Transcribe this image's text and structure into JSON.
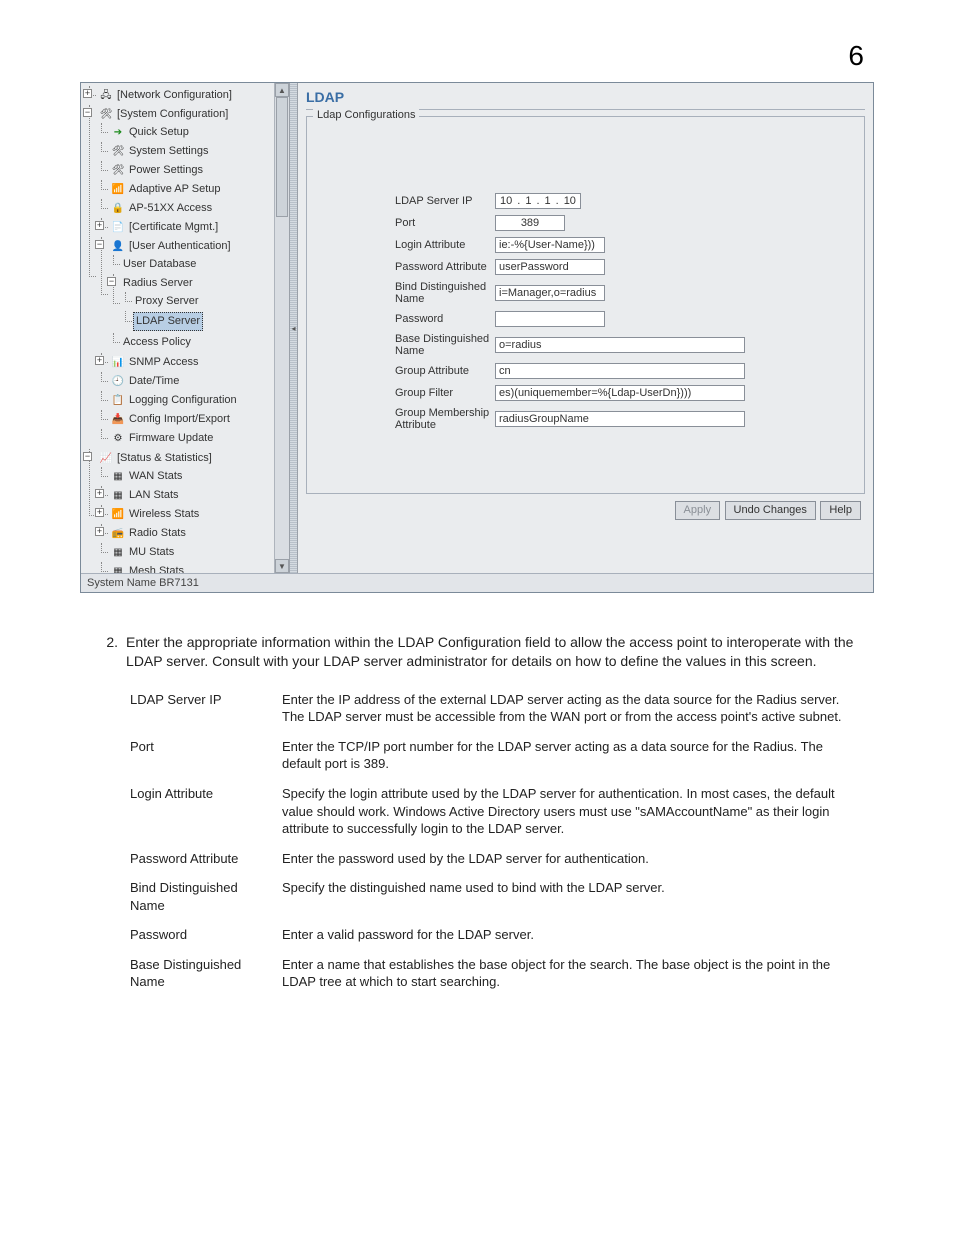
{
  "page_number": "6",
  "tree": {
    "network_configuration": "[Network Configuration]",
    "system_configuration": "[System Configuration]",
    "quick_setup": "Quick Setup",
    "system_settings": "System Settings",
    "power_settings": "Power Settings",
    "adaptive_ap_setup": "Adaptive AP Setup",
    "ap51xx_access": "AP-51XX Access",
    "certificate_mgmt": "[Certificate Mgmt.]",
    "user_authentication": "[User Authentication]",
    "user_database": "User Database",
    "radius_server": "Radius Server",
    "proxy_server": "Proxy Server",
    "ldap_server": "LDAP Server",
    "access_policy": "Access Policy",
    "snmp_access": "SNMP Access",
    "date_time": "Date/Time",
    "logging_configuration": "Logging Configuration",
    "config_import_export": "Config Import/Export",
    "firmware_update": "Firmware Update",
    "status_statistics": "[Status & Statistics]",
    "wan_stats": "WAN Stats",
    "lan_stats": "LAN Stats",
    "wireless_stats": "Wireless Stats",
    "radio_stats": "Radio Stats",
    "mu_stats": "MU Stats",
    "mesh_stats": "Mesh Stats"
  },
  "main": {
    "title": "LDAP",
    "legend": "Ldap Configurations",
    "labels": {
      "ldap_server_ip": "LDAP Server IP",
      "port": "Port",
      "login_attribute": "Login Attribute",
      "password_attribute": "Password Attribute",
      "bind_dn": "Bind Distinguished Name",
      "password": "Password",
      "base_dn": "Base Distinguished Name",
      "group_attribute": "Group Attribute",
      "group_filter": "Group Filter",
      "group_membership_attribute": "Group Membership Attribute"
    },
    "values": {
      "ip_o1": "10",
      "ip_o2": "1",
      "ip_o3": "1",
      "ip_o4": "10",
      "port": "389",
      "login_attribute": "ie:-%{User-Name}))",
      "password_attribute": "userPassword",
      "bind_dn": "i=Manager,o=radius",
      "password": "",
      "base_dn": "o=radius",
      "group_attribute": "cn",
      "group_filter": "es)(uniquemember=%{Ldap-UserDn})))",
      "group_membership_attribute": "radiusGroupName"
    },
    "buttons": {
      "apply": "Apply",
      "undo": "Undo Changes",
      "help": "Help"
    }
  },
  "status_bar": "System Name BR7131",
  "doc": {
    "step_no": "2.",
    "step_text": "Enter the appropriate information within the LDAP Configuration field to allow the access point to interoperate with the LDAP server. Consult with your LDAP server administrator for details on how to define the values in this screen.",
    "defs": [
      {
        "term": "LDAP Server IP",
        "desc": "Enter the IP address of the external LDAP server acting as the data source for the Radius server. The LDAP server must be accessible from the WAN port or from the access point's active subnet."
      },
      {
        "term": "Port",
        "desc": "Enter the TCP/IP port number for the LDAP server acting as a data source for the Radius. The default port is 389."
      },
      {
        "term": "Login Attribute",
        "desc": "Specify the login attribute used by the LDAP server for authentication. In most cases, the default value should work. Windows Active Directory users must use \"sAMAccountName\" as their login attribute to successfully login to the LDAP server."
      },
      {
        "term": "Password Attribute",
        "desc": "Enter the password used by the LDAP server for authentication."
      },
      {
        "term": "Bind Distinguished Name",
        "desc": "Specify the distinguished name used to bind with the LDAP server."
      },
      {
        "term": "Password",
        "desc": "Enter a valid password for the LDAP server."
      },
      {
        "term": "Base Distinguished Name",
        "desc": "Enter a name that establishes the base object for the search. The base object is the point in the LDAP tree at which to start searching."
      }
    ]
  }
}
